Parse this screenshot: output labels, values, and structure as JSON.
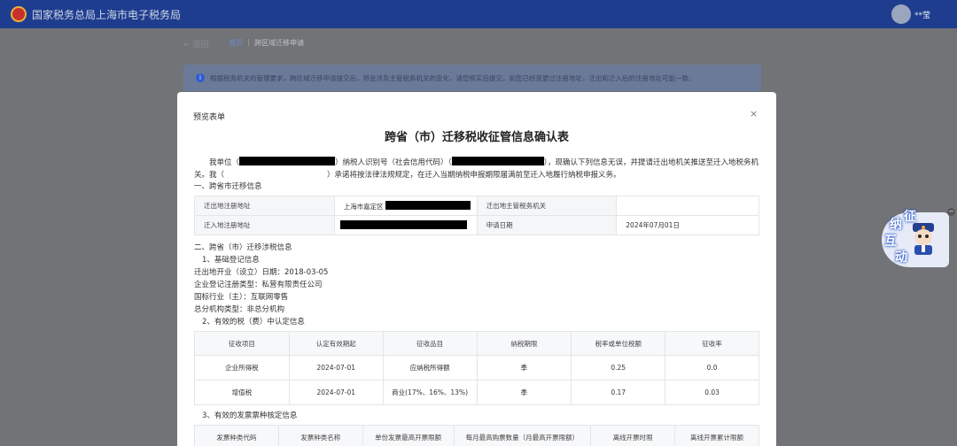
{
  "app": {
    "title": "国家税务总局上海市电子税务局",
    "user": "**莹"
  },
  "nav": {
    "back": "← 返回",
    "breadcrumb_home": "首页",
    "breadcrumb_sep": "｜",
    "breadcrumb_current": "跨区域迁移申请"
  },
  "notice": {
    "icon": "info-icon",
    "text": "根据税务机关的管理要求，跨区域迁移申请提交后，将会涉及主管税务机关的变化，请您核实后提交。如您已经变更过注册地址，迁出和迁入后的注册地址可能一致。"
  },
  "modal": {
    "title": "预览表单",
    "close": "×",
    "doc_title": "跨省（市）迁移税收征管信息确认表",
    "para": {
      "p1": "我单位（",
      "p2": "）纳税人识别号（社会信用代码）（",
      "p3": "），现确认下列信息无误，并提请迁出地机关推送至迁入地税务机关。我（",
      "p4": "）承诺将按法律法规规定，在迁入当期纳税申报期限届满前至迁入地履行纳税申报义务。"
    },
    "section1": "一、跨省市迁移信息",
    "migration": {
      "out_addr_label": "迁出地注册地址",
      "out_addr_value": "上海市嘉定区",
      "out_authority_label": "迁出地主管税务机关",
      "out_authority_value": "",
      "in_addr_label": "迁入地注册地址",
      "date_label": "申请日期",
      "date_value": "2024年07月01日"
    },
    "section2": "二、跨省（市）迁移涉税信息",
    "sub1": "1、基础登记信息",
    "basic": {
      "open_date": "迁出地开业（设立）日期：2018-03-05",
      "reg_type": "企业登记注册类型：私营有限责任公司",
      "industry": "国标行业（主）：互联网零售",
      "branch": "总分机构类型：非总分机构"
    },
    "sub2": "2、有效的税（费）中认定信息",
    "tax_table": {
      "headers": [
        "征收项目",
        "认定有效期起",
        "征收品目",
        "纳税期限",
        "税率或单位税额",
        "征收率"
      ],
      "rows": [
        [
          "企业所得税",
          "2024-07-01",
          "应纳税所得额",
          "季",
          "0.25",
          "0.0"
        ],
        [
          "增值税",
          "2024-07-01",
          "商业(17%、16%、13%)",
          "季",
          "0.17",
          "0.03"
        ]
      ]
    },
    "sub3": "3、有效的发票票种核定信息",
    "invoice_table": {
      "headers": [
        "发票种类代码",
        "发票种类名称",
        "单份发票最高开票限额",
        "每月最高购票数量（月最高开票限额）",
        "离线开票时限",
        "离线开票累计限额"
      ]
    }
  },
  "widget": {
    "chars": [
      "征",
      "纳",
      "互",
      "动"
    ],
    "close": "−"
  }
}
